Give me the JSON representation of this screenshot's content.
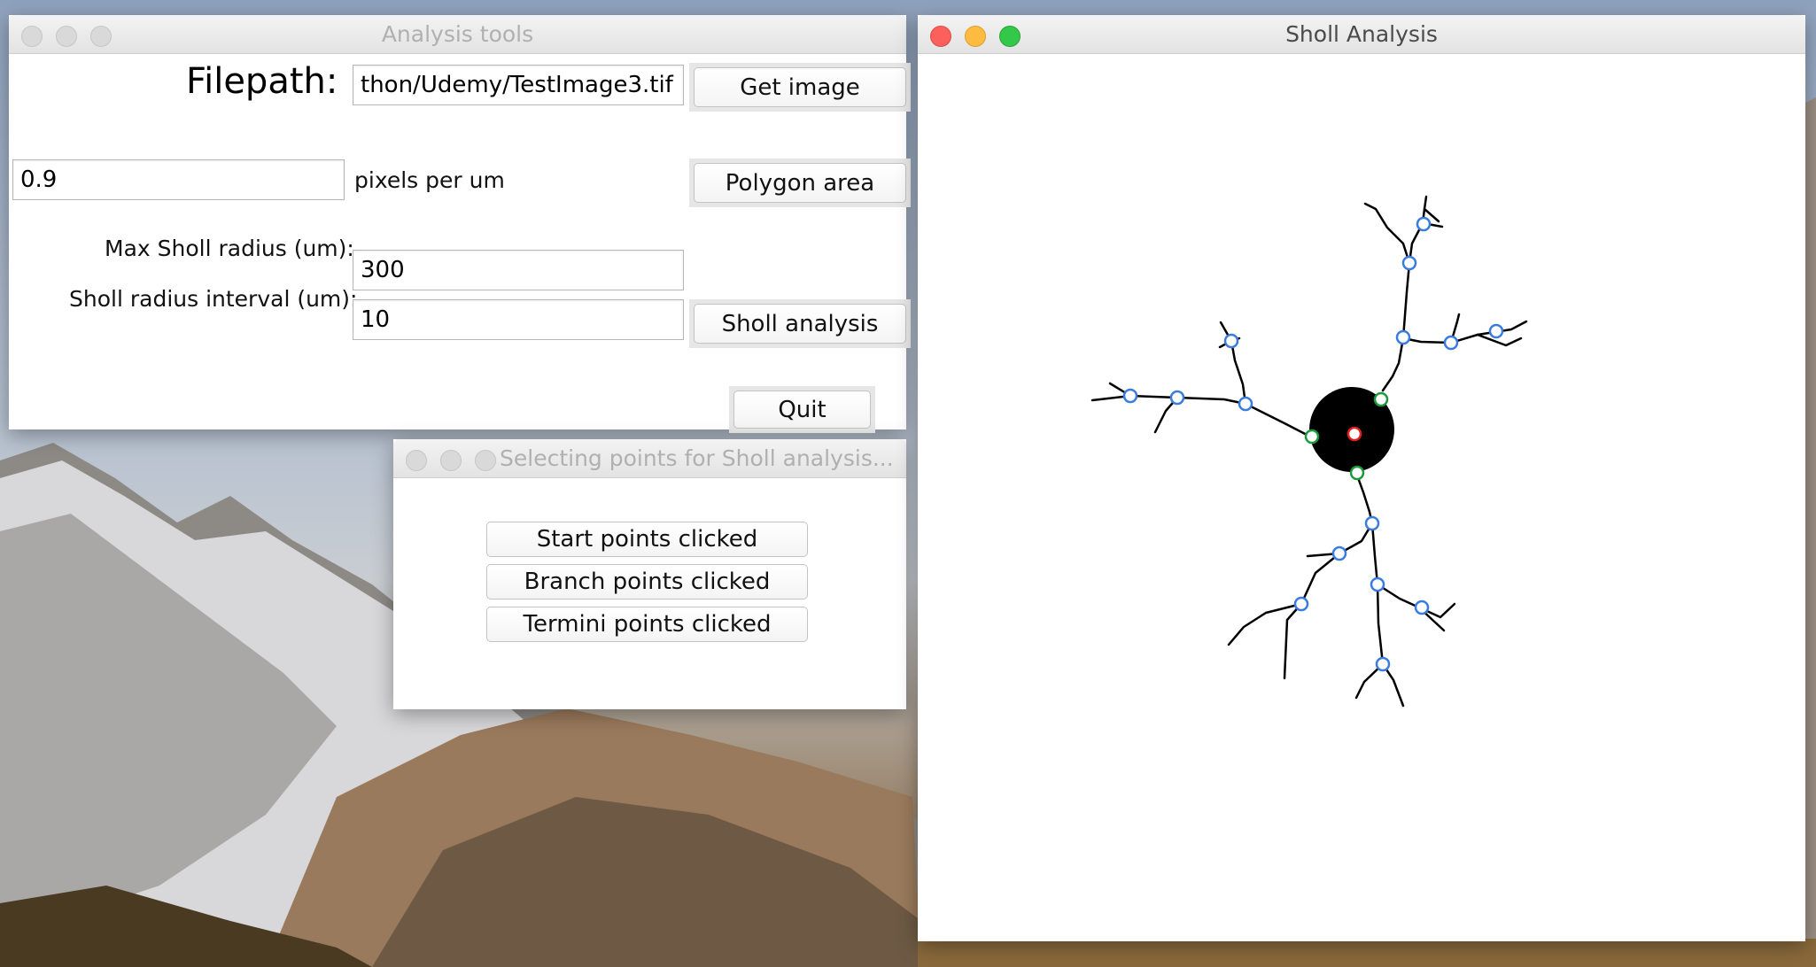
{
  "analysis_window": {
    "title": "Analysis tools",
    "filepath_label": "Filepath:",
    "filepath_value": "thon/Udemy/TestImage3.tif",
    "get_image_label": "Get image",
    "scale_value": "0.9",
    "scale_unit_label": "pixels per um",
    "polygon_area_label": "Polygon area",
    "max_radius_label": "Max Sholl radius (um):",
    "max_radius_value": "300",
    "radius_interval_label": "Sholl radius interval (um):",
    "radius_interval_value": "10",
    "sholl_analysis_label": "Sholl analysis",
    "quit_label": "Quit"
  },
  "selecting_window": {
    "title": "Selecting points for Sholl analysis...",
    "start_points_label": "Start points clicked",
    "branch_points_label": "Branch points clicked",
    "termini_points_label": "Termini points clicked"
  },
  "sholl_window": {
    "title": "Sholl Analysis"
  },
  "colors": {
    "start_point": "#1a9a3a",
    "branch_point": "#3a7be0",
    "soma_center": "#e02020",
    "soma": "#000000"
  }
}
